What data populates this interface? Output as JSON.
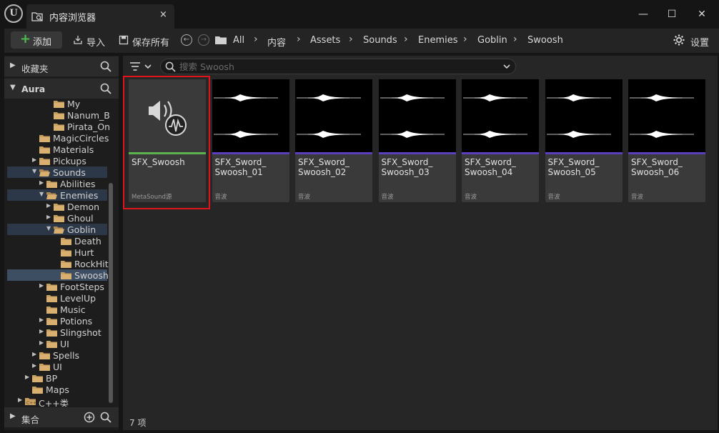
{
  "window": {
    "tab_title": "内容浏览器",
    "tab_close": "×",
    "controls": {
      "minimize": "—",
      "maximize": "☐",
      "close": "✕"
    }
  },
  "toolbar": {
    "add_label": "添加",
    "import_label": "导入",
    "save_all_label": "保存所有",
    "settings_label": "设置",
    "breadcrumbs": [
      "All",
      "内容",
      "Assets",
      "Sounds",
      "Enemies",
      "Goblin",
      "Swoosh"
    ]
  },
  "sidebar": {
    "favorites_label": "收藏夹",
    "project_label": "Aura",
    "collections_label": "集合",
    "tree": [
      {
        "label": "My",
        "depth": 5,
        "expander": "none"
      },
      {
        "label": "Nanum_Bru",
        "depth": 5,
        "expander": "none"
      },
      {
        "label": "Pirata_One",
        "depth": 5,
        "expander": "none"
      },
      {
        "label": "MagicCircles",
        "depth": 3,
        "expander": "none"
      },
      {
        "label": "Materials",
        "depth": 3,
        "expander": "none"
      },
      {
        "label": "Pickups",
        "depth": 3,
        "expander": "collapsed"
      },
      {
        "label": "Sounds",
        "depth": 3,
        "expander": "expanded",
        "state": "highlight"
      },
      {
        "label": "Abilities",
        "depth": 4,
        "expander": "collapsed"
      },
      {
        "label": "Enemies",
        "depth": 4,
        "expander": "expanded",
        "state": "highlight"
      },
      {
        "label": "Demon",
        "depth": 5,
        "expander": "collapsed"
      },
      {
        "label": "Ghoul",
        "depth": 5,
        "expander": "collapsed"
      },
      {
        "label": "Goblin",
        "depth": 5,
        "expander": "expanded",
        "state": "highlight"
      },
      {
        "label": "Death",
        "depth": 6,
        "expander": "none"
      },
      {
        "label": "Hurt",
        "depth": 6,
        "expander": "none"
      },
      {
        "label": "RockHit",
        "depth": 6,
        "expander": "none"
      },
      {
        "label": "Swoosh",
        "depth": 6,
        "expander": "none",
        "state": "selected"
      },
      {
        "label": "FootSteps",
        "depth": 4,
        "expander": "collapsed"
      },
      {
        "label": "LevelUp",
        "depth": 4,
        "expander": "none"
      },
      {
        "label": "Music",
        "depth": 4,
        "expander": "none"
      },
      {
        "label": "Potions",
        "depth": 4,
        "expander": "collapsed"
      },
      {
        "label": "Slingshot",
        "depth": 4,
        "expander": "collapsed"
      },
      {
        "label": "UI",
        "depth": 4,
        "expander": "collapsed"
      },
      {
        "label": "Spells",
        "depth": 3,
        "expander": "collapsed"
      },
      {
        "label": "UI",
        "depth": 3,
        "expander": "collapsed"
      },
      {
        "label": "BP",
        "depth": 2,
        "expander": "collapsed"
      },
      {
        "label": "Maps",
        "depth": 2,
        "expander": "none"
      },
      {
        "label": "C++类",
        "depth": 1,
        "expander": "collapsed",
        "icon": "cpp"
      }
    ]
  },
  "search": {
    "placeholder": "搜索 Swoosh"
  },
  "assets": [
    {
      "name": "SFX_Swoosh",
      "type": "MetaSound源",
      "kind": "metasound",
      "bar_color": "#5db34f"
    },
    {
      "name": "SFX_Sword_\nSwoosh_01",
      "type": "音波",
      "kind": "wave",
      "bar_color": "#5b3fbf"
    },
    {
      "name": "SFX_Sword_\nSwoosh_02",
      "type": "音波",
      "kind": "wave",
      "bar_color": "#5b3fbf"
    },
    {
      "name": "SFX_Sword_\nSwoosh_03",
      "type": "音波",
      "kind": "wave",
      "bar_color": "#5b3fbf"
    },
    {
      "name": "SFX_Sword_\nSwoosh_04",
      "type": "音波",
      "kind": "wave",
      "bar_color": "#5b3fbf"
    },
    {
      "name": "SFX_Sword_\nSwoosh_05",
      "type": "音波",
      "kind": "wave",
      "bar_color": "#5b3fbf"
    },
    {
      "name": "SFX_Sword_\nSwoosh_06",
      "type": "音波",
      "kind": "wave",
      "bar_color": "#5b3fbf"
    }
  ],
  "status": {
    "item_count": "7 项"
  },
  "colors": {
    "folder": "#c9a062",
    "selection_outline": "#e0141c",
    "tree_selected": "#3d4e63",
    "add_plus": "#4fbe4f"
  }
}
